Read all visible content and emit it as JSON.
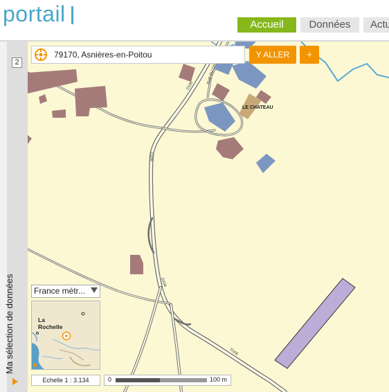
{
  "header": {
    "logo_text": "portail",
    "nav_tabs": [
      "Accueil",
      "Données",
      "Actu"
    ],
    "active_tab": "Accueil",
    "accent_color": "#86b81b",
    "logo_color": "#4aa6c9"
  },
  "side_panel": {
    "badge": "2",
    "label": "Ma sélection de données"
  },
  "search": {
    "value": "79170, Asnières-en-Poitou",
    "go_label": "Y ALLER",
    "plus_label": "+",
    "button_color": "#f29400",
    "icon": "target-crosshair-icon"
  },
  "map": {
    "labels": {
      "chateau": "LE CHATEAU",
      "road_rue": "RUE DU CH.",
      "road_d106": "D106",
      "road_d106b": "D106",
      "road_d106c": "D106",
      "road_d106d": "D106"
    },
    "colors": {
      "background": "#fbf8d3",
      "building_brown": "#a57b7a",
      "building_blue": "#7b97c1",
      "building_tan": "#c9a877",
      "parcel_purple": "#bcadd8",
      "river": "#59a8d9"
    }
  },
  "overview": {
    "select_value": "France métr...",
    "city_label": "La Rochelle",
    "city_label_line1": "La",
    "city_label_line2": "Rochelle"
  },
  "scale": {
    "ratio_label": "Echelle 1 :",
    "ratio_value": "3.134",
    "ratio_text": "Echelle 1 :   3.134",
    "zero": "0",
    "max": "100 m"
  }
}
